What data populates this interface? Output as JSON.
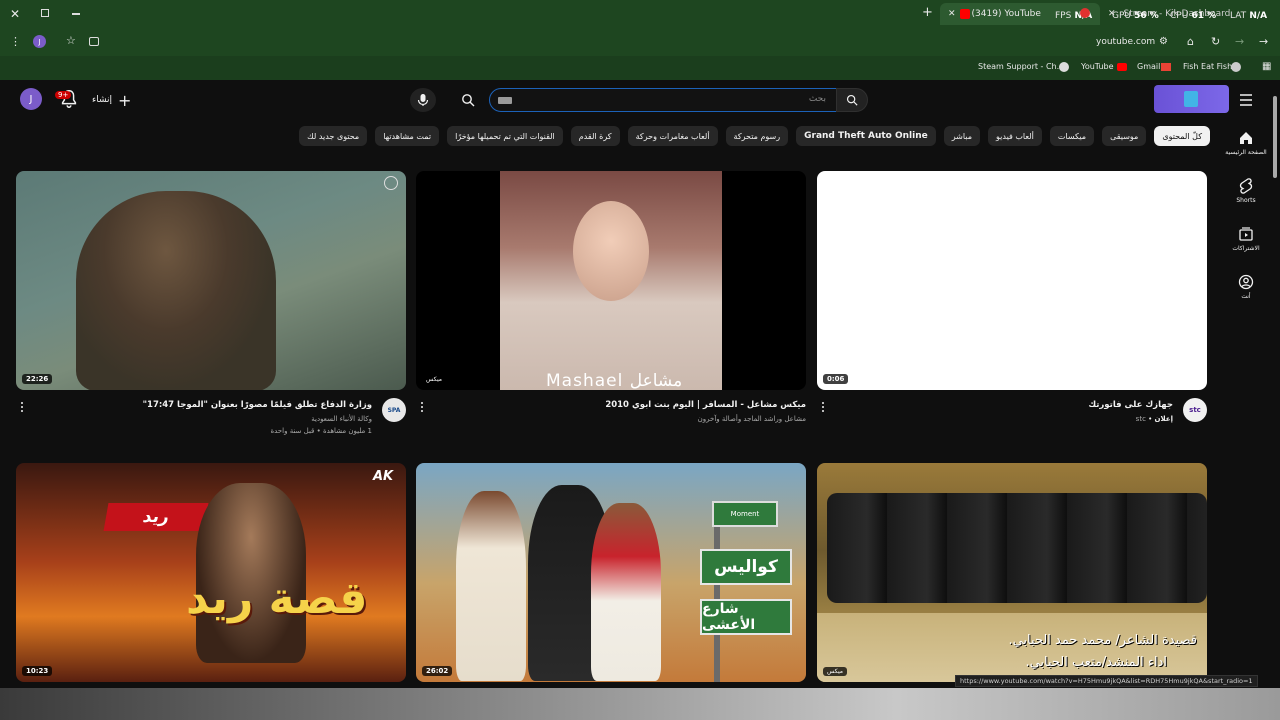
{
  "browser": {
    "tabs": [
      {
        "title": "(3419) YouTube",
        "active": true
      },
      {
        "title": "Stream - Kik Dashboard",
        "active": false
      }
    ],
    "hud": {
      "fps_label": "FPS",
      "fps_value": "N/A",
      "gpu_label": "GPU",
      "gpu_value": "56 %",
      "cpu_label": "CPU",
      "cpu_value": "61 %",
      "lat_label": "LAT",
      "lat_value": "N/A"
    },
    "url": "youtube.com",
    "profile_initial": "J",
    "bookmarks": [
      "Steam Support - Ch...",
      "YouTube",
      "Gmail",
      "Fish Eat Fish"
    ]
  },
  "youtube": {
    "user_initial": "J",
    "notifications_badge": "9+",
    "create_label": "إنشاء",
    "search_placeholder": "بحث",
    "chips": [
      {
        "label": "كلّ المحتوى",
        "active": true
      },
      {
        "label": "موسيقى"
      },
      {
        "label": "ميكسات"
      },
      {
        "label": "ألعاب فيديو"
      },
      {
        "label": "مباشر"
      },
      {
        "label": "Grand Theft Auto Online",
        "bold": true
      },
      {
        "label": "رسوم متحركة"
      },
      {
        "label": "ألعاب مغامرات وحركة"
      },
      {
        "label": "كرة القدم"
      },
      {
        "label": "القنوات التي تم تحميلها مؤخرًا"
      },
      {
        "label": "تمت مشاهدتها"
      },
      {
        "label": "محتوى جديد لك"
      }
    ],
    "guide": [
      {
        "label": "الصفحة الرئيسية",
        "icon": "home-icon"
      },
      {
        "label": "Shorts",
        "icon": "shorts-icon"
      },
      {
        "label": "الاشتراكات",
        "icon": "subscriptions-icon"
      },
      {
        "label": "أنت",
        "icon": "you-icon"
      }
    ],
    "videos": [
      {
        "title": "وزارة الدفاع تطلق فيلمًا مصورًا بعنوان \"الموجا 17:47\"",
        "channel": "وكالة الأنباء السعودية",
        "stats": "1 مليون مشاهدة • قبل سنة واحدة",
        "duration": "22:26",
        "channel_avatar": "SPA"
      },
      {
        "title": "ميكس مشاعل - المسافر | اليوم بنت ابوي 2010",
        "channel": "مشاعل وراشد الماجد وأصالة وآخرون",
        "stats": "",
        "duration": "ميكس",
        "channel_avatar": ""
      },
      {
        "title": "جهازك على فاتورتك",
        "channel": "stc",
        "stats": "",
        "ad_label": "إعلان",
        "duration": "0:06",
        "channel_avatar": "stc"
      },
      {
        "title": "",
        "channel": "",
        "stats": "",
        "duration": "10:23",
        "thumb_text": "قصة ريد",
        "thumb_tag": "ريد",
        "corner_logo": "AK"
      },
      {
        "title": "",
        "channel": "",
        "stats": "",
        "duration": "26:02",
        "sign_top": "كواليس",
        "sign_bottom": "شارع الأعشى",
        "sign_badge": "Moment"
      },
      {
        "title": "",
        "channel": "",
        "stats": "",
        "duration": "ميكس",
        "poem_line1": "قصيدة الشاعر/ محمد حمد الحبابي.",
        "poem_line2": "اداء المنشد/متعب الحبابي."
      }
    ],
    "thumb2_caption": "Mashael مشاعل",
    "status_url": "https://www.youtube.com/watch?v=H75Hmu9jkQA&list=RDH75Hmu9jkQA&start_radio=1"
  },
  "colors": {
    "chrome_green": "#1e4620",
    "yt_bg": "#0f0f0f",
    "accent_blue": "#1c62b9",
    "badge_red": "#cc0000"
  }
}
